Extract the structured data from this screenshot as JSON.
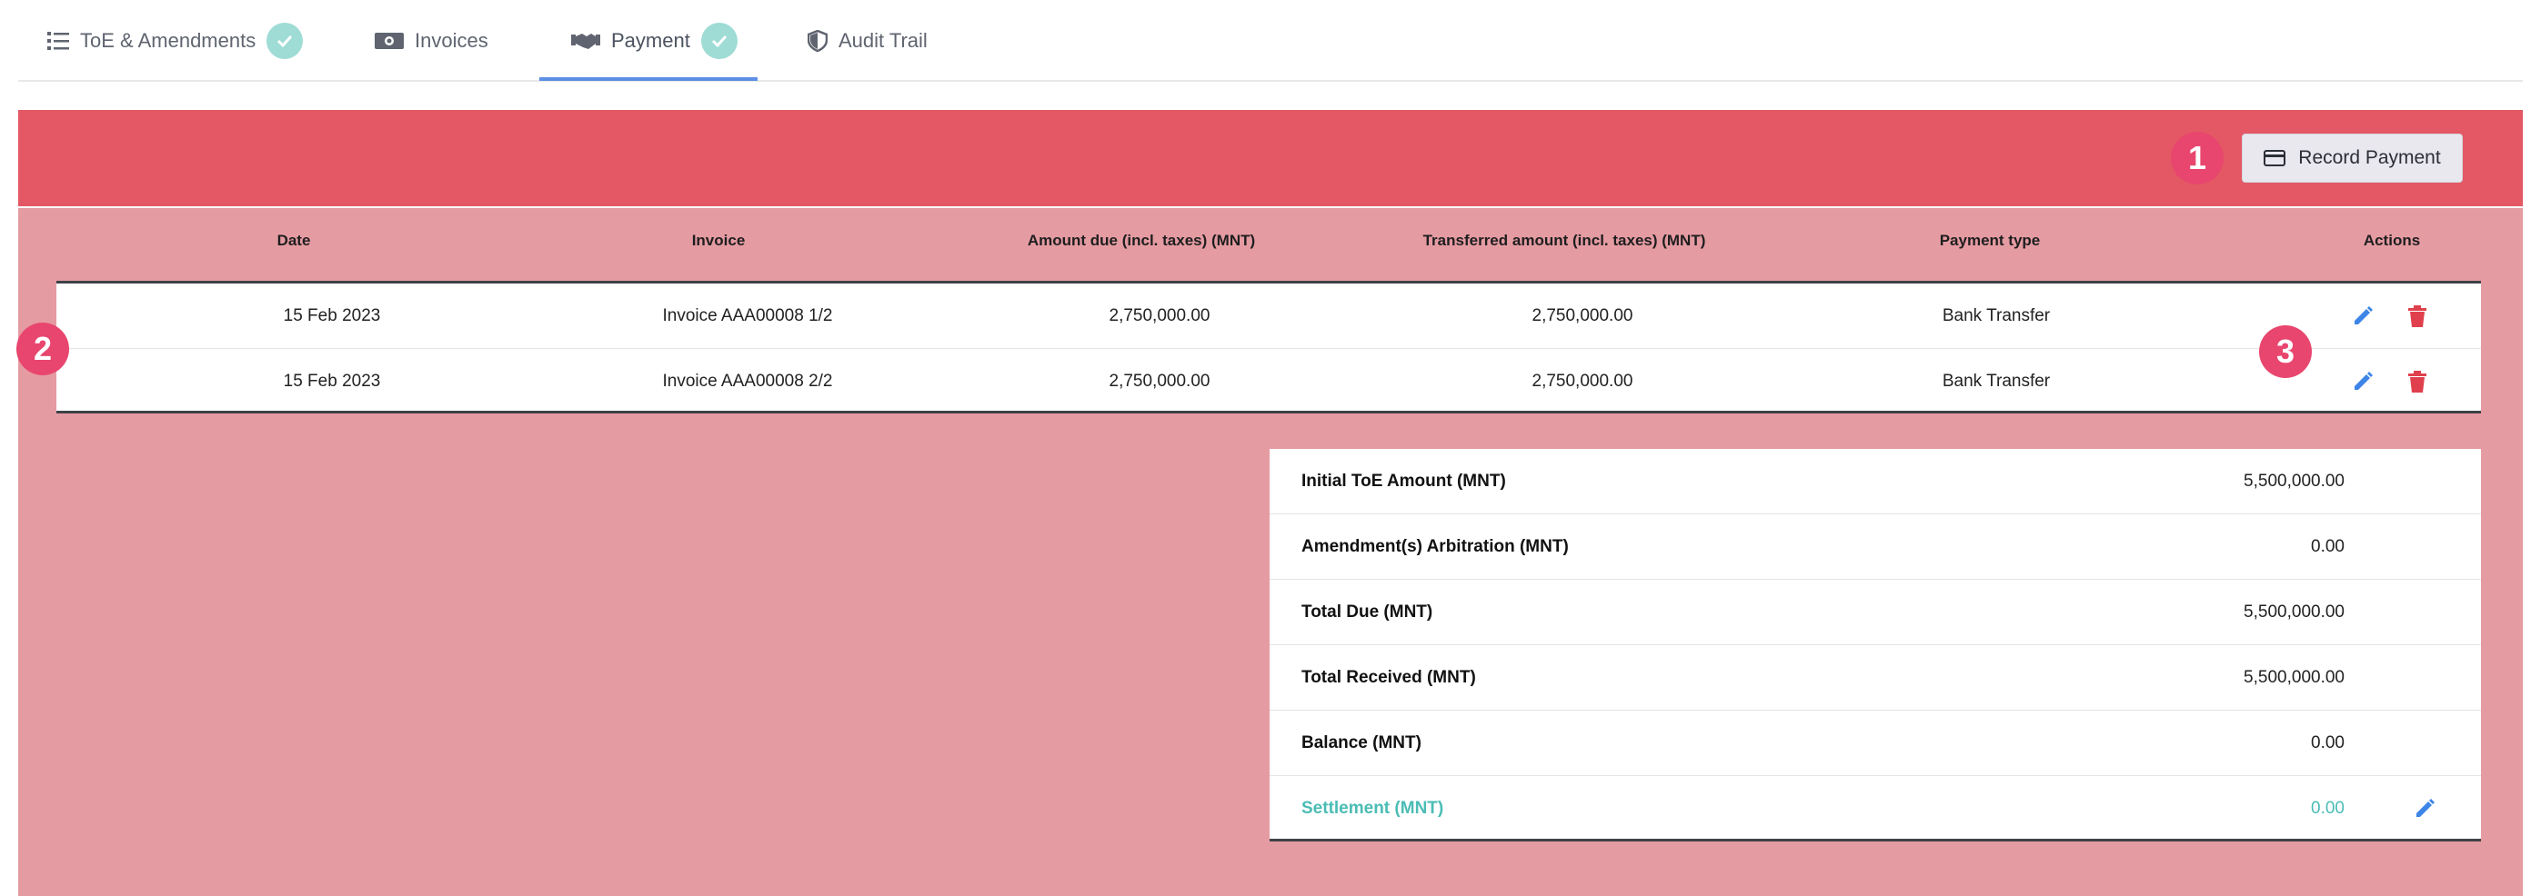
{
  "tabs": [
    {
      "label": "ToE & Amendments",
      "checked": true
    },
    {
      "label": "Invoices",
      "checked": false
    },
    {
      "label": "Payment",
      "checked": true
    },
    {
      "label": "Audit Trail",
      "checked": false
    }
  ],
  "header": {
    "record_payment_label": "Record Payment"
  },
  "annotations": {
    "badge1": "1",
    "badge2": "2",
    "badge3": "3"
  },
  "payments_table": {
    "columns": [
      "Date",
      "Invoice",
      "Amount due (incl. taxes) (MNT)",
      "Transferred amount (incl. taxes) (MNT)",
      "Payment type",
      "Actions"
    ],
    "rows": [
      {
        "date": "15 Feb 2023",
        "invoice": "Invoice AAA00008 1/2",
        "amount_due": "2,750,000.00",
        "transferred": "2,750,000.00",
        "payment_type": "Bank Transfer"
      },
      {
        "date": "15 Feb 2023",
        "invoice": "Invoice AAA00008 2/2",
        "amount_due": "2,750,000.00",
        "transferred": "2,750,000.00",
        "payment_type": "Bank Transfer"
      }
    ]
  },
  "summary": [
    {
      "label": "Initial ToE Amount (MNT)",
      "value": "5,500,000.00"
    },
    {
      "label": "Amendment(s) Arbitration (MNT)",
      "value": "0.00"
    },
    {
      "label": "Total Due (MNT)",
      "value": "5,500,000.00"
    },
    {
      "label": "Total Received (MNT)",
      "value": "5,500,000.00"
    },
    {
      "label": "Balance (MNT)",
      "value": "0.00"
    },
    {
      "label": "Settlement (MNT)",
      "value": "0.00"
    }
  ],
  "colors": {
    "header_red": "#e35864",
    "panel_pink": "#e59ba2",
    "badge": "#e8466e",
    "teal": "#4bbcb5",
    "edit_blue": "#3d85e6",
    "delete_red": "#e0404d",
    "tab_underline": "#5c8fe4"
  },
  "icons": {
    "toe_tab": "list-icon",
    "invoices_tab": "money-icon",
    "payment_tab": "handshake-icon",
    "audit_tab": "shield-icon",
    "record_payment": "credit-card-icon",
    "edit": "pencil-icon",
    "delete": "trash-icon",
    "check": "check-icon"
  }
}
